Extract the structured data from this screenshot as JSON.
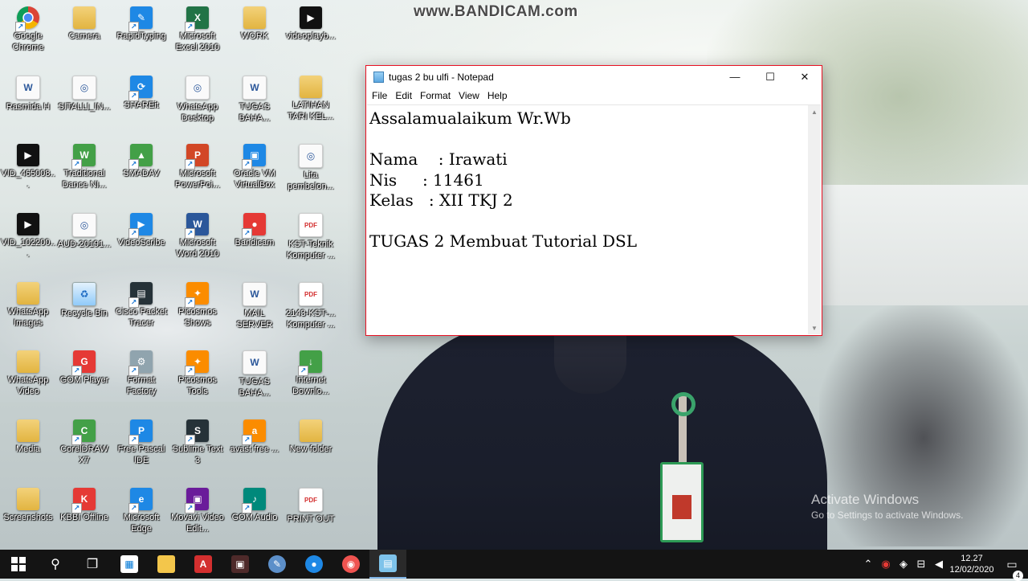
{
  "watermark": "www.BANDICAM.com",
  "desktop_icons": [
    {
      "label": "Google Chrome",
      "icon": "chrome-icon"
    },
    {
      "label": "Camera",
      "icon": "folder-icon"
    },
    {
      "label": "RapidTyping",
      "icon": "rapidtyping-icon"
    },
    {
      "label": "Microsoft Excel 2010",
      "icon": "excel-icon"
    },
    {
      "label": "WORK",
      "icon": "folder-icon"
    },
    {
      "label": "videoplayb...",
      "icon": "video-file-icon"
    },
    {
      "label": "Rasmida H",
      "icon": "word-doc-icon"
    },
    {
      "label": "SITALLI_IN...",
      "icon": "file-icon"
    },
    {
      "label": "SHAREit",
      "icon": "shareit-icon"
    },
    {
      "label": "WhatsApp Desktop",
      "icon": "file-icon"
    },
    {
      "label": "TUGAS BAHA...",
      "icon": "word-doc-icon"
    },
    {
      "label": "LATIHAN TARI KEL...",
      "icon": "folder-icon"
    },
    {
      "label": "VID_465008...",
      "icon": "video-file-icon"
    },
    {
      "label": "Traditional Dance NI...",
      "icon": "webm-icon"
    },
    {
      "label": "SMADAV",
      "icon": "smadav-icon"
    },
    {
      "label": "Microsoft PowerPoi...",
      "icon": "powerpoint-icon"
    },
    {
      "label": "Oracle VM VirtualBox",
      "icon": "virtualbox-icon"
    },
    {
      "label": "Lita pembelon...",
      "icon": "file-icon"
    },
    {
      "label": "VID_102200...",
      "icon": "video-file-icon"
    },
    {
      "label": "AUD-20191...",
      "icon": "file-icon"
    },
    {
      "label": "VideoScribe",
      "icon": "videoscribe-icon"
    },
    {
      "label": "Microsoft Word 2010",
      "icon": "word-icon"
    },
    {
      "label": "Bandicam",
      "icon": "bandicam-icon"
    },
    {
      "label": "KST-Teknik Komputer ...",
      "icon": "pdf-icon"
    },
    {
      "label": "WhatsApp Images",
      "icon": "folder-icon"
    },
    {
      "label": "Recycle Bin",
      "icon": "recycle-bin-icon"
    },
    {
      "label": "Cisco Packet Tracer",
      "icon": "packet-tracer-icon"
    },
    {
      "label": "Picosmos Shows",
      "icon": "picosmos-icon"
    },
    {
      "label": "MAIL SERVER KELOMPOK...",
      "icon": "word-doc-icon"
    },
    {
      "label": "2143-KST-... Komputer ...",
      "icon": "pdf-icon"
    },
    {
      "label": "WhatsApp Video",
      "icon": "folder-icon"
    },
    {
      "label": "GOM Player",
      "icon": "gom-player-icon"
    },
    {
      "label": "Format Factory",
      "icon": "format-factory-icon"
    },
    {
      "label": "Picosmos Tools",
      "icon": "picosmos-icon"
    },
    {
      "label": "TUGAS BAHA...",
      "icon": "word-doc-icon"
    },
    {
      "label": "Internet Downlo...",
      "icon": "idm-icon"
    },
    {
      "label": "Media",
      "icon": "folder-icon"
    },
    {
      "label": "CorelDRAW X7",
      "icon": "coreldraw-icon"
    },
    {
      "label": "Free Pascal IDE",
      "icon": "pascal-icon"
    },
    {
      "label": "Sublime Text 3",
      "icon": "sublime-icon"
    },
    {
      "label": "avast free ...",
      "icon": "avast-icon"
    },
    {
      "label": "New folder",
      "icon": "folder-icon"
    },
    {
      "label": "Screenshots",
      "icon": "folder-icon"
    },
    {
      "label": "KBBI Offline",
      "icon": "kbbi-icon"
    },
    {
      "label": "Microsoft Edge",
      "icon": "edge-icon"
    },
    {
      "label": "Movavi Video Edit...",
      "icon": "movavi-icon"
    },
    {
      "label": "GOM Audio",
      "icon": "gom-audio-icon"
    },
    {
      "label": "PRINT OUT",
      "icon": "pdf-icon"
    }
  ],
  "notepad": {
    "title": "tugas 2 bu ulfi - Notepad",
    "menu": [
      "File",
      "Edit",
      "Format",
      "View",
      "Help"
    ],
    "content": "Assalamualaikum Wr.Wb\n\nNama    : Irawati\nNis     : 11461\nKelas   : XII TKJ 2\n\nTUGAS 2 Membuat Tutorial DSL",
    "minimize": "—",
    "maximize": "☐",
    "close": "✕"
  },
  "activation": {
    "line1": "Activate Windows",
    "line2": "Go to Settings to activate Windows."
  },
  "taskbar": {
    "apps": [
      "start-icon",
      "search-icon",
      "task-view-icon",
      "store-icon",
      "file-explorer-icon",
      "pdf-reader-icon",
      "movavi-icon",
      "rapidtyping-icon",
      "chrome-icon",
      "gom-player-icon",
      "notepad-icon"
    ],
    "time": "12.27",
    "date": "12/02/2020",
    "notification_count": "4"
  }
}
